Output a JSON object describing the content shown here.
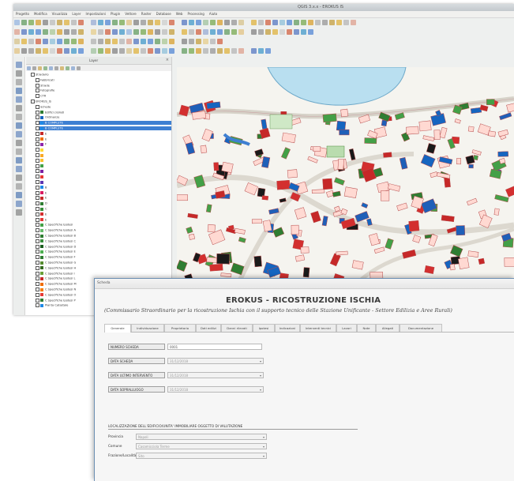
{
  "gis_window": {
    "title": "QGIS 3.x.x - EROKUS IS",
    "menus": [
      "Progetto",
      "Modifica",
      "Visualizza",
      "Layer",
      "Impostazioni",
      "Plugin",
      "Vettore",
      "Raster",
      "Database",
      "Web",
      "Processing",
      "Aiuto"
    ],
    "layers_panel": {
      "header": "Layer",
      "rows": [
        {
          "label": "Stradario",
          "swatch": "",
          "selected": false,
          "indent": 1
        },
        {
          "label": "Fabbricati",
          "swatch": "",
          "selected": false,
          "indent": 2
        },
        {
          "label": "Strade",
          "swatch": "",
          "selected": false,
          "indent": 2
        },
        {
          "label": "Fotografie",
          "swatch": "",
          "selected": false,
          "indent": 2
        },
        {
          "label": "CTR",
          "swatch": "",
          "selected": false,
          "indent": 2
        },
        {
          "label": "EROKUS_IS",
          "swatch": "",
          "selected": false,
          "indent": 1
        },
        {
          "label": "Schede",
          "swatch": "",
          "selected": false,
          "indent": 2
        },
        {
          "label": "Edifici crollati",
          "swatch": "#2e7d32",
          "selected": false,
          "indent": 2
        },
        {
          "label": "Ordinanze",
          "swatch": "#1565c0",
          "selected": false,
          "indent": 2
        },
        {
          "label": "B COMPLETE",
          "swatch": "#1e88e5",
          "selected": true,
          "indent": 2
        },
        {
          "label": "B COMPLETE",
          "swatch": "#1e88e5",
          "selected": true,
          "indent": 2
        },
        {
          "label": "E",
          "swatch": "#c62828",
          "selected": false,
          "indent": 2
        },
        {
          "label": "E",
          "swatch": "#ef6c00",
          "selected": false,
          "indent": 2
        },
        {
          "label": "F",
          "swatch": "#8e24aa",
          "selected": false,
          "indent": 2
        },
        {
          "label": "",
          "swatch": "#fdd835",
          "selected": false,
          "indent": 2
        },
        {
          "label": "",
          "swatch": "#f9a825",
          "selected": false,
          "indent": 2
        },
        {
          "label": "",
          "swatch": "#fbc02d",
          "selected": false,
          "indent": 2
        },
        {
          "label": "",
          "swatch": "#43a047",
          "selected": false,
          "indent": 2
        },
        {
          "label": "",
          "swatch": "#7b1fa2",
          "selected": false,
          "indent": 2
        },
        {
          "label": "",
          "swatch": "#e53935",
          "selected": false,
          "indent": 2
        },
        {
          "label": "",
          "swatch": "#5e35b1",
          "selected": false,
          "indent": 2
        },
        {
          "label": "B",
          "swatch": "#1e88e5",
          "selected": false,
          "indent": 2
        },
        {
          "label": "E",
          "swatch": "#d81b60",
          "selected": false,
          "indent": 2
        },
        {
          "label": "E",
          "swatch": "#c62828",
          "selected": false,
          "indent": 2
        },
        {
          "label": "D",
          "swatch": "#2e7d32",
          "selected": false,
          "indent": 2
        },
        {
          "label": "C",
          "swatch": "#388e3c",
          "selected": false,
          "indent": 2
        },
        {
          "label": "E",
          "swatch": "#d32f2f",
          "selected": false,
          "indent": 2
        },
        {
          "label": "E",
          "swatch": "#e53935",
          "selected": false,
          "indent": 2
        },
        {
          "label": "C Specifiche Ipotesi",
          "swatch": "#43a047",
          "selected": false,
          "indent": 2
        },
        {
          "label": "C Specifiche Ipotesi A",
          "swatch": "#66bb6a",
          "selected": false,
          "indent": 2
        },
        {
          "label": "C Specifiche Ipotesi B",
          "swatch": "#2e7d32",
          "selected": false,
          "indent": 2
        },
        {
          "label": "C Specifiche Ipotesi C",
          "swatch": "#388e3c",
          "selected": false,
          "indent": 2
        },
        {
          "label": "C Specifiche Ipotesi D",
          "swatch": "#1b5e20",
          "selected": false,
          "indent": 2
        },
        {
          "label": "C Specifiche Ipotesi E",
          "swatch": "#4caf50",
          "selected": false,
          "indent": 2
        },
        {
          "label": "C Specifiche Ipotesi F",
          "swatch": "#2e7d32",
          "selected": false,
          "indent": 2
        },
        {
          "label": "C Specifiche Ipotesi G",
          "swatch": "#558b2f",
          "selected": false,
          "indent": 2
        },
        {
          "label": "C Specifiche Ipotesi H",
          "swatch": "#33691e",
          "selected": false,
          "indent": 2
        },
        {
          "label": "C Specifiche Ipotesi I",
          "swatch": "#689f38",
          "selected": false,
          "indent": 2
        },
        {
          "label": "C Specifiche Ipotesi L",
          "swatch": "#c62828",
          "selected": false,
          "indent": 2
        },
        {
          "label": "C Specifiche Ipotesi M",
          "swatch": "#ef6c00",
          "selected": false,
          "indent": 2
        },
        {
          "label": "C Specifiche Ipotesi N",
          "swatch": "#f57c00",
          "selected": false,
          "indent": 2
        },
        {
          "label": "C Specifiche Ipotesi O",
          "swatch": "#e53935",
          "selected": false,
          "indent": 2
        },
        {
          "label": "C Specifiche Ipotesi P",
          "swatch": "#2e7d32",
          "selected": false,
          "indent": 2
        },
        {
          "label": "Pianta Catastale",
          "swatch": "#1e88e5",
          "selected": false,
          "indent": 2
        }
      ]
    }
  },
  "form_window": {
    "title": "Scheda",
    "heading": "EROKUS - RICOSTRUZIONE ISCHIA",
    "subtitle": "(Commissario Straordinario per la ricostruzione Ischia con il supporto tecnico delle Stazione Unificante - Settore Edilizia e Aree Rurali)",
    "tabs": [
      "Generale",
      "Individuazione",
      "Proprietario",
      "Dati edilizi",
      "Danni rilevati",
      "Ipotesi",
      "Indicazioni",
      "Interventi tecnici",
      "Lavori",
      "Note",
      "Allegati",
      "Documentazione"
    ],
    "active_tab": 0,
    "fields": [
      {
        "label": "NUMERO SCHEDA",
        "value": "0001",
        "disabled": false,
        "dropdown": false
      },
      {
        "label": "DATA SCHEDA",
        "value": "31/12/2018",
        "disabled": true,
        "dropdown": true
      },
      {
        "label": "DATA ULTIMO INTERVENTO",
        "value": "31/12/2018",
        "disabled": true,
        "dropdown": true
      },
      {
        "label": "DATA SOPRALLUOGO",
        "value": "31/12/2018",
        "disabled": true,
        "dropdown": true
      }
    ],
    "section": {
      "title": "LOCALIZZAZIONE DELL'EDIFICIO/UNITA' IMMOBILIARE OGGETTO DI VALUTAZIONE",
      "rows": [
        {
          "label": "Provincia",
          "value": "Napoli"
        },
        {
          "label": "Comune",
          "value": "Casamicciola Terme"
        },
        {
          "label": "Frazione/Località",
          "value": "Sito"
        }
      ]
    }
  }
}
